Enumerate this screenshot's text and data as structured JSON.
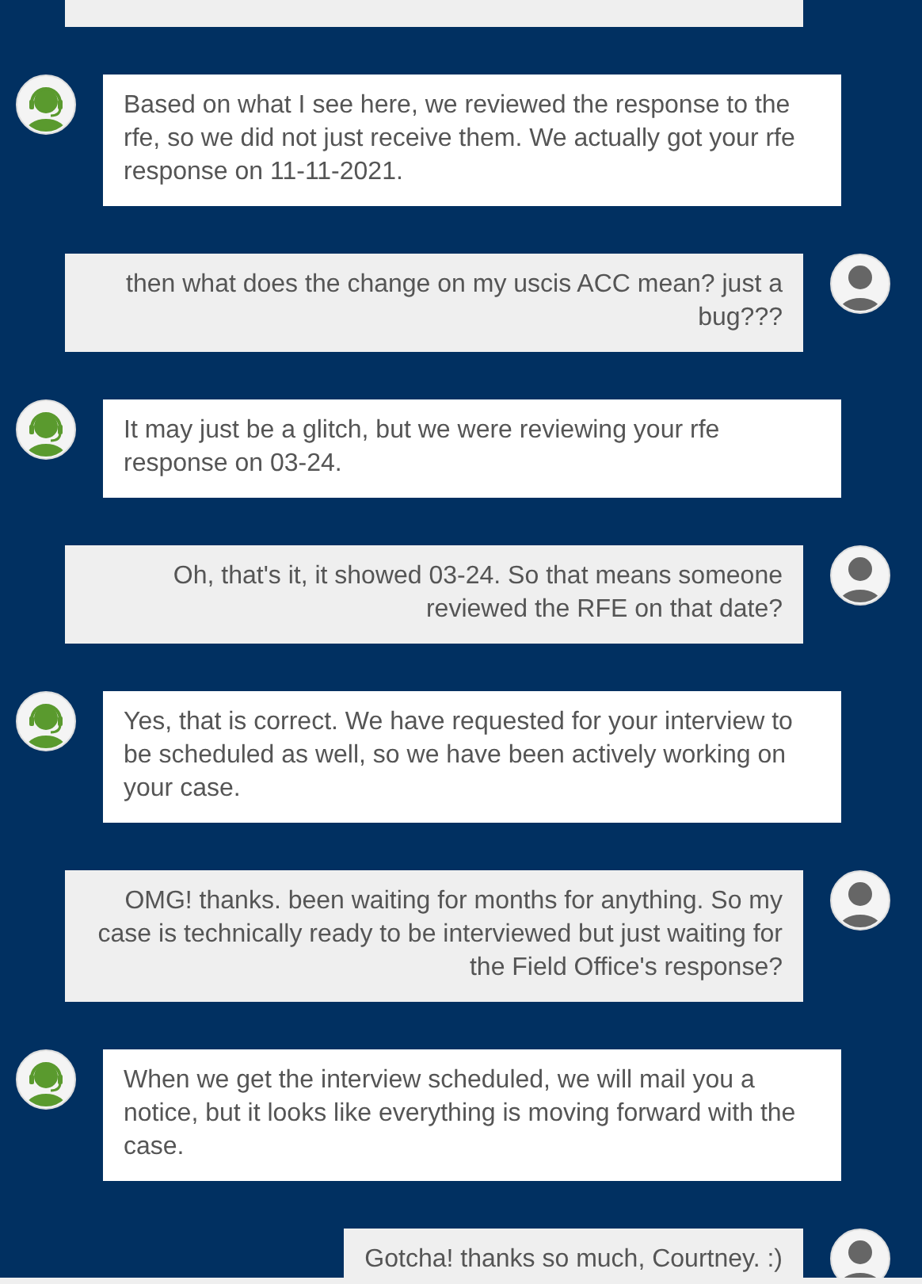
{
  "messages": [
    {
      "kind": "agent",
      "text": "Based on what I see here, we reviewed the response to the rfe, so we did not just receive them. We actually got your rfe response on 11-11-2021."
    },
    {
      "kind": "user",
      "text": "then what does the change on my uscis ACC mean? just a bug???"
    },
    {
      "kind": "agent",
      "text": "It may just be a glitch, but we were reviewing your rfe response on 03-24."
    },
    {
      "kind": "user",
      "text": "Oh, that's it, it showed 03-24. So that means someone reviewed the RFE on that date?"
    },
    {
      "kind": "agent",
      "text": "Yes, that is correct. We have requested for your interview to be scheduled as well, so we have been actively working on your case."
    },
    {
      "kind": "user",
      "text": "OMG! thanks. been waiting for months for anything. So my case is technically ready to be interviewed but just waiting for the Field Office's response?"
    },
    {
      "kind": "agent",
      "text": "When we get the interview scheduled, we will mail you a notice, but it looks like everything is moving forward with the case."
    },
    {
      "kind": "user",
      "text": "Gotcha! thanks so much, Courtney. :)"
    }
  ]
}
